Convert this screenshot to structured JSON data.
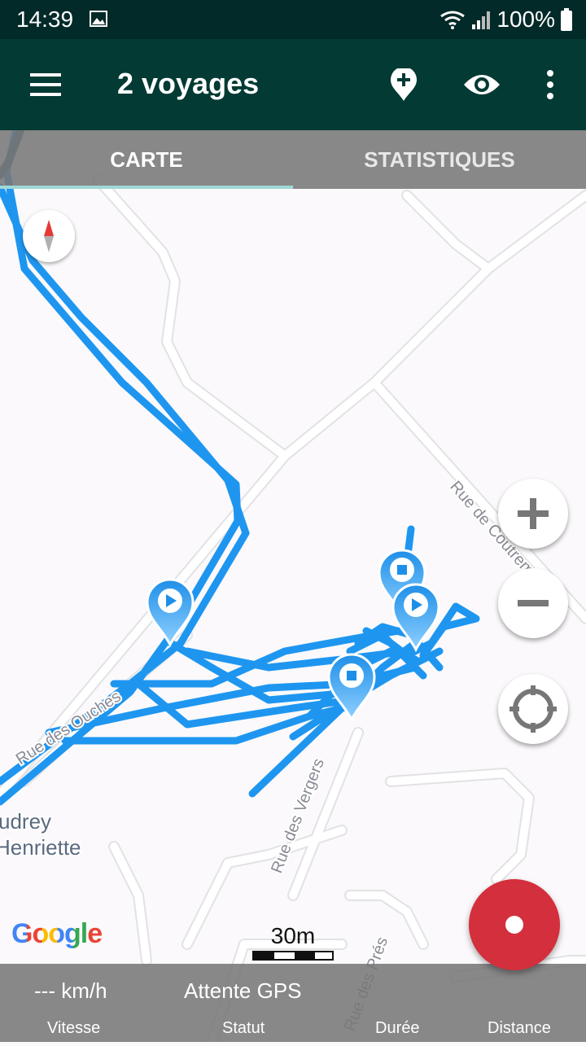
{
  "status_bar": {
    "time": "14:39",
    "battery": "100%"
  },
  "toolbar": {
    "title": "2 voyages"
  },
  "tabs": [
    {
      "label": "CARTE",
      "active": true
    },
    {
      "label": "STATISTIQUES",
      "active": false
    }
  ],
  "map": {
    "streets": [
      "Rue de Coutremont",
      "Rue des Ouches",
      "Rue des Vergers",
      "Rue des Prés"
    ],
    "place_lines": [
      "udrey",
      "Henriette"
    ],
    "attribution": "Google",
    "scale_label": "30m"
  },
  "bottom_bar": {
    "speed_value": "--- km/h",
    "status_value": "Attente GPS",
    "labels": {
      "speed": "Vitesse",
      "status": "Statut",
      "duration": "Durée",
      "distance": "Distance"
    }
  },
  "colors": {
    "status_bar": "#022a28",
    "toolbar": "#033a34",
    "track": "#1e96f0",
    "record": "#d32f3c",
    "tab_indicator": "#9fd8d6"
  }
}
